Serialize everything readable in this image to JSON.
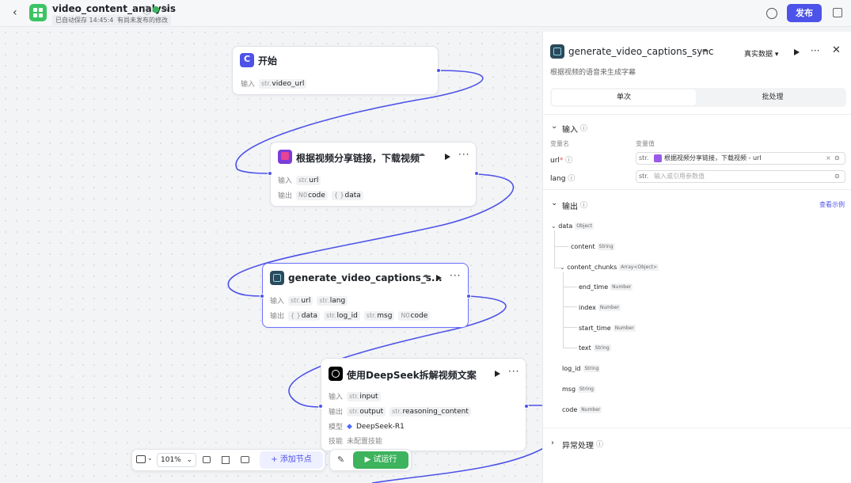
{
  "header": {
    "app_title": "video_content_analysis",
    "saved_text": "已自动保存 14:45:46",
    "unpublished_text": "有尚未发布的修改",
    "publish_label": "发布"
  },
  "nodes": {
    "start": {
      "title": "开始",
      "input_label": "输入",
      "inputs": [
        {
          "type": "str.",
          "name": "video_url"
        }
      ]
    },
    "download": {
      "title": "根据视频分享链接，下载视频",
      "input_label": "输入",
      "output_label": "输出",
      "inputs": [
        {
          "type": "str.",
          "name": "url"
        }
      ],
      "outputs": [
        {
          "type": "N0",
          "name": "code"
        },
        {
          "type": "{ }",
          "name": "data"
        }
      ]
    },
    "captions": {
      "title": "generate_video_captions_s...",
      "input_label": "输入",
      "output_label": "输出",
      "inputs": [
        {
          "type": "str.",
          "name": "url"
        },
        {
          "type": "str.",
          "name": "lang"
        }
      ],
      "outputs": [
        {
          "type": "{ }",
          "name": "data"
        },
        {
          "type": "str.",
          "name": "log_id"
        },
        {
          "type": "str.",
          "name": "msg"
        },
        {
          "type": "N0",
          "name": "code"
        }
      ]
    },
    "deepseek": {
      "title": "使用DeepSeek拆解视频文案",
      "input_label": "输入",
      "output_label": "输出",
      "model_label": "模型",
      "skill_label": "技能",
      "inputs": [
        {
          "type": "str.",
          "name": "input"
        }
      ],
      "outputs": [
        {
          "type": "str.",
          "name": "output"
        },
        {
          "type": "str.",
          "name": "reasoning_content"
        }
      ],
      "model": "DeepSeek-R1",
      "skill": "未配置技能"
    }
  },
  "toolbar": {
    "zoom": "101%",
    "add_node": "添加节点",
    "test_run": "试运行"
  },
  "panel": {
    "title": "generate_video_captions_sync",
    "description": "根据视频的语音来生成字幕",
    "data_mode": "真实数据",
    "tabs": [
      "单次",
      "批处理"
    ],
    "input_section": "输入",
    "col_name": "变量名",
    "col_value": "变量值",
    "input_rows": [
      {
        "name": "url",
        "required": "*",
        "type": "str.",
        "value": "根据视频分享链接，下载视频 - url"
      },
      {
        "name": "lang",
        "required": "",
        "type": "str.",
        "placeholder": "输入或引用参数值"
      }
    ],
    "output_section": "输出",
    "view_example": "查看示例",
    "output_tree": [
      {
        "name": "data",
        "type": "Object"
      },
      {
        "name": "content",
        "type": "String"
      },
      {
        "name": "content_chunks",
        "type": "Array<Object>"
      },
      {
        "name": "end_time",
        "type": "Number"
      },
      {
        "name": "index",
        "type": "Number"
      },
      {
        "name": "start_time",
        "type": "Number"
      },
      {
        "name": "text",
        "type": "String"
      },
      {
        "name": "log_id",
        "type": "String"
      },
      {
        "name": "msg",
        "type": "String"
      },
      {
        "name": "code",
        "type": "Number"
      }
    ],
    "exception_section": "异常处理"
  },
  "colors": {
    "accent": "#4d53e8",
    "green": "#3cb35c"
  }
}
